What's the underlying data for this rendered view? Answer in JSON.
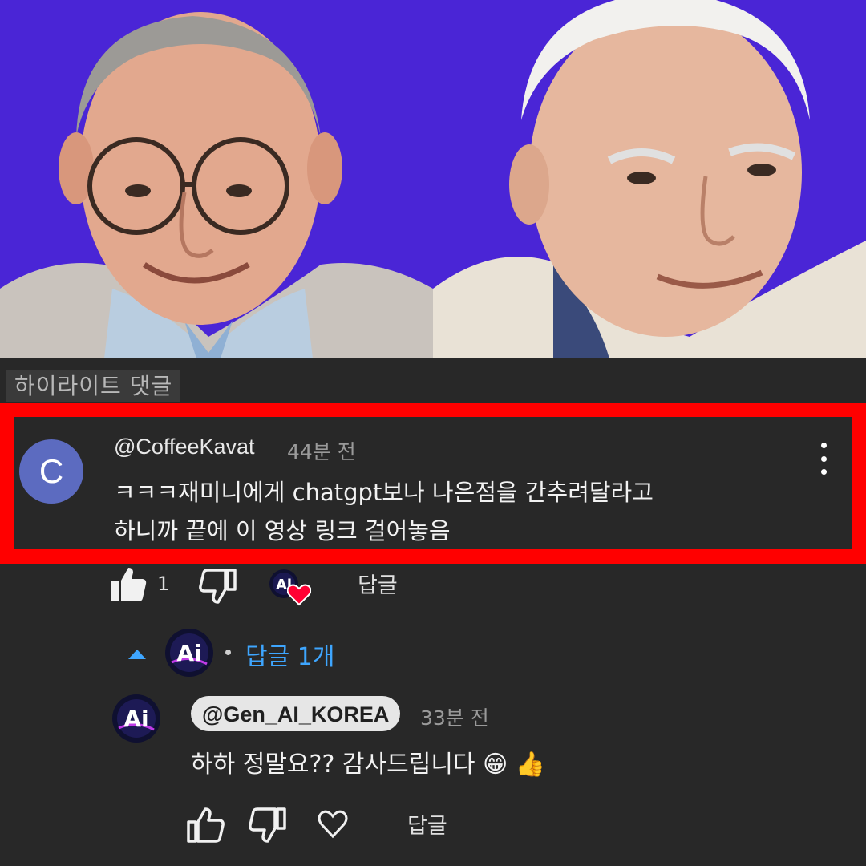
{
  "section_label": "하이라이트 댓글",
  "comment": {
    "avatar_letter": "C",
    "author": "@CoffeeKavat",
    "time": "44분 전",
    "text_lines": [
      "ㅋㅋㅋ재미니에게 chatgpt보나 나은점을 간추려달라고",
      "하니까 끝에 이 영상 링크 걸어놓음"
    ],
    "like_count": "1",
    "reply_label": "답글",
    "hearted": true
  },
  "replies_toggle": {
    "label": "답글 1개"
  },
  "reply": {
    "author": "@Gen_AI_KOREA",
    "time": "33분 전",
    "text": "하하 정말요?? 감사드립니다 😁 👍",
    "reply_label": "답글"
  },
  "colors": {
    "hero_background": "#4a25d6",
    "highlight_frame": "#ff0000",
    "link_blue": "#3ea6ff",
    "page_background": "#282828"
  }
}
